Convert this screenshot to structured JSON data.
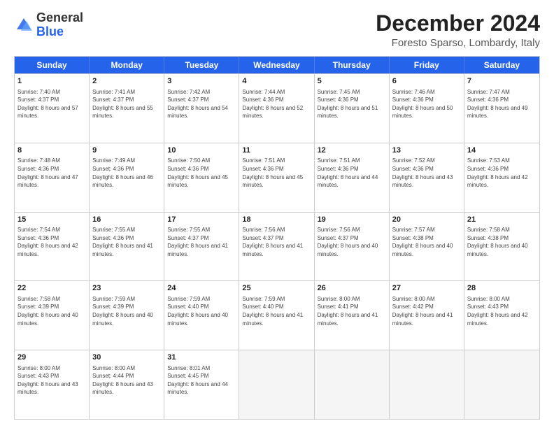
{
  "logo": {
    "general": "General",
    "blue": "Blue"
  },
  "header": {
    "title": "December 2024",
    "subtitle": "Foresto Sparso, Lombardy, Italy"
  },
  "days": [
    "Sunday",
    "Monday",
    "Tuesday",
    "Wednesday",
    "Thursday",
    "Friday",
    "Saturday"
  ],
  "rows": [
    [
      {
        "day": "1",
        "rise": "Sunrise: 7:40 AM",
        "set": "Sunset: 4:37 PM",
        "daylight": "Daylight: 8 hours and 57 minutes."
      },
      {
        "day": "2",
        "rise": "Sunrise: 7:41 AM",
        "set": "Sunset: 4:37 PM",
        "daylight": "Daylight: 8 hours and 55 minutes."
      },
      {
        "day": "3",
        "rise": "Sunrise: 7:42 AM",
        "set": "Sunset: 4:37 PM",
        "daylight": "Daylight: 8 hours and 54 minutes."
      },
      {
        "day": "4",
        "rise": "Sunrise: 7:44 AM",
        "set": "Sunset: 4:36 PM",
        "daylight": "Daylight: 8 hours and 52 minutes."
      },
      {
        "day": "5",
        "rise": "Sunrise: 7:45 AM",
        "set": "Sunset: 4:36 PM",
        "daylight": "Daylight: 8 hours and 51 minutes."
      },
      {
        "day": "6",
        "rise": "Sunrise: 7:46 AM",
        "set": "Sunset: 4:36 PM",
        "daylight": "Daylight: 8 hours and 50 minutes."
      },
      {
        "day": "7",
        "rise": "Sunrise: 7:47 AM",
        "set": "Sunset: 4:36 PM",
        "daylight": "Daylight: 8 hours and 49 minutes."
      }
    ],
    [
      {
        "day": "8",
        "rise": "Sunrise: 7:48 AM",
        "set": "Sunset: 4:36 PM",
        "daylight": "Daylight: 8 hours and 47 minutes."
      },
      {
        "day": "9",
        "rise": "Sunrise: 7:49 AM",
        "set": "Sunset: 4:36 PM",
        "daylight": "Daylight: 8 hours and 46 minutes."
      },
      {
        "day": "10",
        "rise": "Sunrise: 7:50 AM",
        "set": "Sunset: 4:36 PM",
        "daylight": "Daylight: 8 hours and 45 minutes."
      },
      {
        "day": "11",
        "rise": "Sunrise: 7:51 AM",
        "set": "Sunset: 4:36 PM",
        "daylight": "Daylight: 8 hours and 45 minutes."
      },
      {
        "day": "12",
        "rise": "Sunrise: 7:51 AM",
        "set": "Sunset: 4:36 PM",
        "daylight": "Daylight: 8 hours and 44 minutes."
      },
      {
        "day": "13",
        "rise": "Sunrise: 7:52 AM",
        "set": "Sunset: 4:36 PM",
        "daylight": "Daylight: 8 hours and 43 minutes."
      },
      {
        "day": "14",
        "rise": "Sunrise: 7:53 AM",
        "set": "Sunset: 4:36 PM",
        "daylight": "Daylight: 8 hours and 42 minutes."
      }
    ],
    [
      {
        "day": "15",
        "rise": "Sunrise: 7:54 AM",
        "set": "Sunset: 4:36 PM",
        "daylight": "Daylight: 8 hours and 42 minutes."
      },
      {
        "day": "16",
        "rise": "Sunrise: 7:55 AM",
        "set": "Sunset: 4:36 PM",
        "daylight": "Daylight: 8 hours and 41 minutes."
      },
      {
        "day": "17",
        "rise": "Sunrise: 7:55 AM",
        "set": "Sunset: 4:37 PM",
        "daylight": "Daylight: 8 hours and 41 minutes."
      },
      {
        "day": "18",
        "rise": "Sunrise: 7:56 AM",
        "set": "Sunset: 4:37 PM",
        "daylight": "Daylight: 8 hours and 41 minutes."
      },
      {
        "day": "19",
        "rise": "Sunrise: 7:56 AM",
        "set": "Sunset: 4:37 PM",
        "daylight": "Daylight: 8 hours and 40 minutes."
      },
      {
        "day": "20",
        "rise": "Sunrise: 7:57 AM",
        "set": "Sunset: 4:38 PM",
        "daylight": "Daylight: 8 hours and 40 minutes."
      },
      {
        "day": "21",
        "rise": "Sunrise: 7:58 AM",
        "set": "Sunset: 4:38 PM",
        "daylight": "Daylight: 8 hours and 40 minutes."
      }
    ],
    [
      {
        "day": "22",
        "rise": "Sunrise: 7:58 AM",
        "set": "Sunset: 4:39 PM",
        "daylight": "Daylight: 8 hours and 40 minutes."
      },
      {
        "day": "23",
        "rise": "Sunrise: 7:59 AM",
        "set": "Sunset: 4:39 PM",
        "daylight": "Daylight: 8 hours and 40 minutes."
      },
      {
        "day": "24",
        "rise": "Sunrise: 7:59 AM",
        "set": "Sunset: 4:40 PM",
        "daylight": "Daylight: 8 hours and 40 minutes."
      },
      {
        "day": "25",
        "rise": "Sunrise: 7:59 AM",
        "set": "Sunset: 4:40 PM",
        "daylight": "Daylight: 8 hours and 41 minutes."
      },
      {
        "day": "26",
        "rise": "Sunrise: 8:00 AM",
        "set": "Sunset: 4:41 PM",
        "daylight": "Daylight: 8 hours and 41 minutes."
      },
      {
        "day": "27",
        "rise": "Sunrise: 8:00 AM",
        "set": "Sunset: 4:42 PM",
        "daylight": "Daylight: 8 hours and 41 minutes."
      },
      {
        "day": "28",
        "rise": "Sunrise: 8:00 AM",
        "set": "Sunset: 4:43 PM",
        "daylight": "Daylight: 8 hours and 42 minutes."
      }
    ],
    [
      {
        "day": "29",
        "rise": "Sunrise: 8:00 AM",
        "set": "Sunset: 4:43 PM",
        "daylight": "Daylight: 8 hours and 43 minutes."
      },
      {
        "day": "30",
        "rise": "Sunrise: 8:00 AM",
        "set": "Sunset: 4:44 PM",
        "daylight": "Daylight: 8 hours and 43 minutes."
      },
      {
        "day": "31",
        "rise": "Sunrise: 8:01 AM",
        "set": "Sunset: 4:45 PM",
        "daylight": "Daylight: 8 hours and 44 minutes."
      },
      null,
      null,
      null,
      null
    ]
  ]
}
